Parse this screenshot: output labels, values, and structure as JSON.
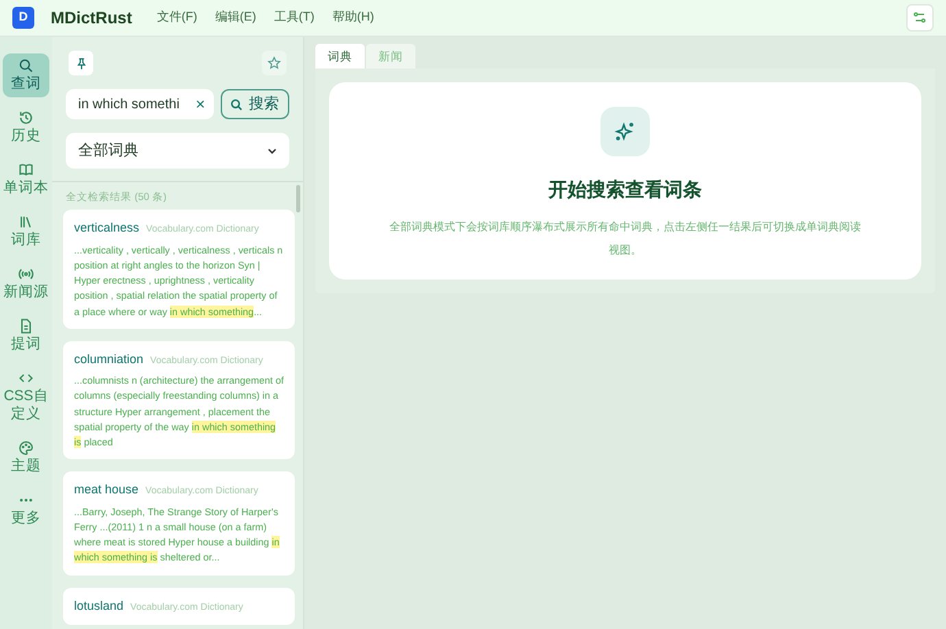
{
  "app": {
    "logo": "D",
    "title": "MDictRust",
    "menu": [
      "文件(F)",
      "编辑(E)",
      "工具(T)",
      "帮助(H)"
    ]
  },
  "nav": [
    {
      "label": "查词",
      "selected": true
    },
    {
      "label": "历史",
      "selected": false
    },
    {
      "label": "单词本",
      "selected": false
    },
    {
      "label": "词库",
      "selected": false
    },
    {
      "label": "新闻源",
      "selected": false
    },
    {
      "label": "提词",
      "selected": false
    },
    {
      "label": "CSS自定义",
      "selected": false
    },
    {
      "label": "主题",
      "selected": false
    },
    {
      "label": "更多",
      "selected": false
    }
  ],
  "search": {
    "value": "in which somethi",
    "clear": "×",
    "button": "搜索",
    "dictionary": "全部词典"
  },
  "results_label": "全文检索结果 (50 条)",
  "results": [
    {
      "word": "verticalness",
      "source": "Vocabulary.com Dictionary",
      "before": "...verticality , vertically , verticalness , verticals n position at right angles to the horizon Syn | Hyper erectness , uprightness , verticality position , spatial relation the spatial property of a place where or way ",
      "highlight": "in which something",
      "after": "..."
    },
    {
      "word": "columniation",
      "source": "Vocabulary.com Dictionary",
      "before": "...columnists n (architecture) the arrangement of columns (especially freestanding columns) in a structure Hyper arrangement , placement the spatial property of the way ",
      "highlight": "in which something is",
      "after": " placed"
    },
    {
      "word": "meat house",
      "source": "Vocabulary.com Dictionary",
      "before": "...Barry, Joseph, The Strange Story of Harper's Ferry ...(2011) 1 n a small house (on a farm) where meat is stored Hyper house a building ",
      "highlight": "in which something is",
      "after": " sheltered or..."
    },
    {
      "word": "lotusland",
      "source": "Vocabulary.com Dictionary"
    }
  ],
  "tabs": [
    {
      "label": "词典",
      "selected": true
    },
    {
      "label": "新闻",
      "selected": false
    }
  ],
  "empty_state": {
    "title": "开始搜索查看词条",
    "description": "全部词典模式下会按词库顺序瀑布式展示所有命中词典，点击左侧任一结果后可切换成单词典阅读视图。"
  }
}
